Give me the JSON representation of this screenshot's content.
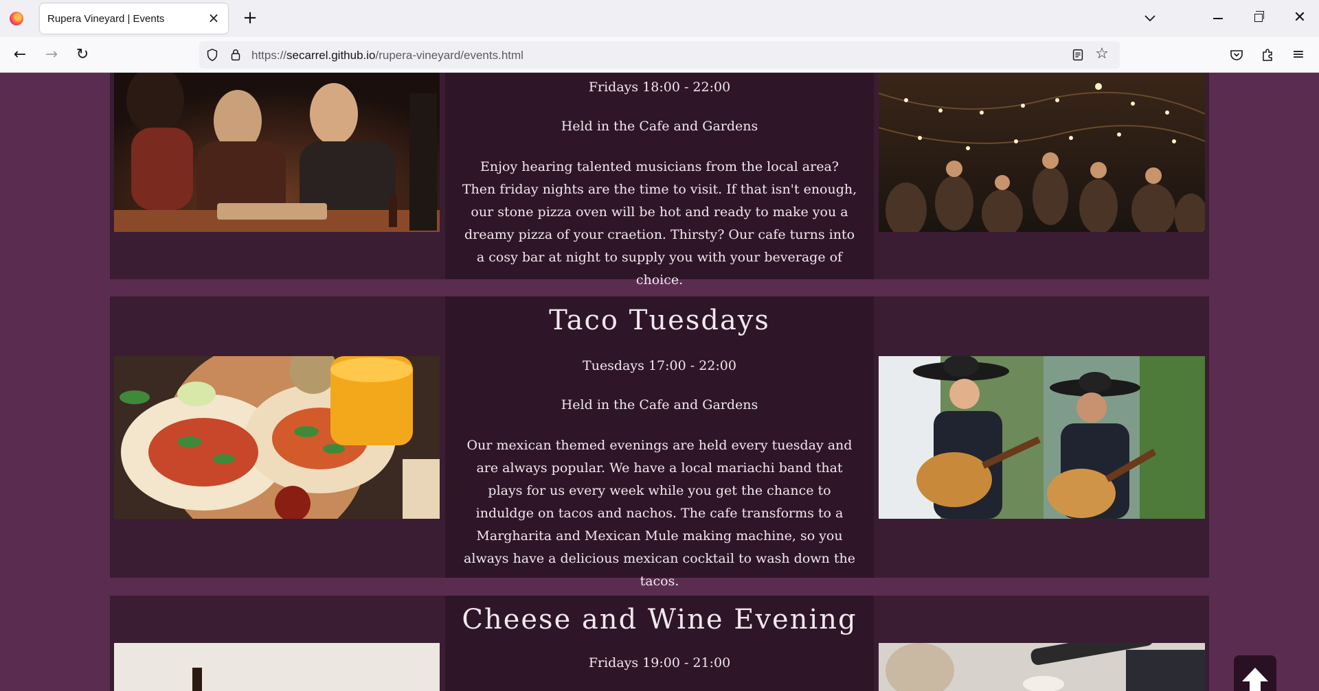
{
  "browser": {
    "tab_title": "Rupera Vineyard | Events",
    "url_prefix": "https://",
    "url_host": "secarrel.github.io",
    "url_path": "/rupera-vineyard/events.html"
  },
  "colors": {
    "page_background": "#5a2d50",
    "card_background": "#3b1d33",
    "card_center": "#2e1628",
    "text": "#f2e8ee"
  },
  "events": [
    {
      "title": "",
      "schedule": "Fridays 18:00 - 22:00",
      "location": "Held in the Cafe and Gardens",
      "description": "Enjoy hearing talented musicians from the local area? Then friday nights are the time to visit. If that isn't enough, our stone pizza oven will be hot and ready to make you a dreamy pizza of your craetion. Thirsty? Our cafe turns into a cosy bar at night to supply you with your beverage of choice."
    },
    {
      "title": "Taco Tuesdays",
      "schedule": "Tuesdays 17:00 - 22:00",
      "location": "Held in the Cafe and Gardens",
      "description": "Our mexican themed evenings are held every tuesday and are always popular. We have a local mariachi band that plays for us every week while you get the chance to induldge on tacos and nachos. The cafe transforms to a Margharita and Mexican Mule making machine, so you always have a delicious mexican cocktail to wash down the tacos."
    },
    {
      "title": "Cheese and Wine Evening",
      "schedule": "Fridays 19:00 - 21:00"
    }
  ],
  "icons": {
    "back": "arrow-left-icon",
    "forward": "arrow-right-icon",
    "reload": "reload-icon",
    "back_to_top": "arrow-up-icon"
  }
}
